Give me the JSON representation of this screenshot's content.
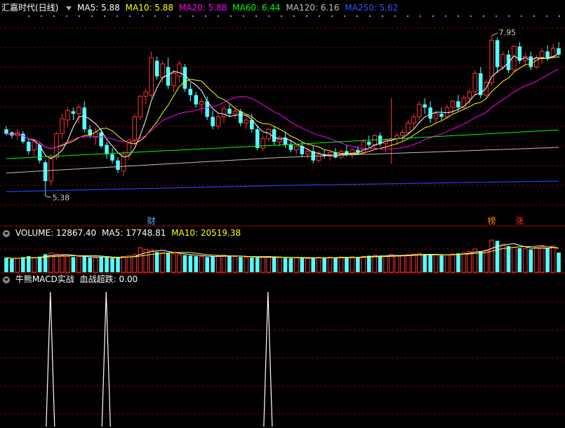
{
  "main_header": {
    "title": "汇嘉时代(日线)",
    "indicators": [
      {
        "label": "MA5: 5.88",
        "color": "#ffffff"
      },
      {
        "label": "MA10: 5.88",
        "color": "#ffff00"
      },
      {
        "label": "MA20: 5.88",
        "color": "#ff00ff"
      },
      {
        "label": "MA60: 6.44",
        "color": "#00ff00"
      },
      {
        "label": "MA120: 6.16",
        "color": "#c0c0c0"
      },
      {
        "label": "MA250: 5.62",
        "color": "#0000ff"
      }
    ]
  },
  "volume_header": {
    "indicators": [
      {
        "label": "VOLUME: 12867.40",
        "color": "#ffffff"
      },
      {
        "label": "MA5: 17748.81",
        "color": "#ffffff"
      },
      {
        "label": "MA10: 20519.38",
        "color": "#ffff00"
      }
    ]
  },
  "macd_header": {
    "name": "牛熊MACD实战",
    "indicator": "血战超跌: 0.00"
  },
  "colors": {
    "up": "#ff3232",
    "down": "#54ffff",
    "grid": "#7f0000",
    "frame": "#a00000"
  },
  "chart_data": [
    {
      "type": "candlestick",
      "title": "汇嘉时代(日线)",
      "annotations": [
        {
          "text": "7.95",
          "kind": "high_label",
          "index": 87
        },
        {
          "text": "5.38",
          "kind": "low_label",
          "index": 7
        }
      ],
      "event_markers": [
        {
          "text": "财",
          "index": 26,
          "color": "#5fafff"
        },
        {
          "text": "榜",
          "index": 87,
          "color": "#ff8c00"
        },
        {
          "text": "涨",
          "index": 92,
          "color": "#ff3232"
        }
      ],
      "ohlc": [
        [
          6.45,
          6.5,
          6.35,
          6.38
        ],
        [
          6.4,
          6.42,
          6.3,
          6.35
        ],
        [
          6.35,
          6.45,
          6.28,
          6.4
        ],
        [
          6.38,
          6.42,
          6.22,
          6.25
        ],
        [
          6.25,
          6.3,
          6.05,
          6.1
        ],
        [
          6.12,
          6.28,
          6.02,
          6.25
        ],
        [
          6.2,
          6.24,
          5.9,
          5.95
        ],
        [
          5.92,
          5.95,
          5.38,
          5.62
        ],
        [
          5.62,
          6.05,
          5.55,
          5.98
        ],
        [
          6.0,
          6.4,
          5.96,
          6.38
        ],
        [
          6.38,
          6.7,
          6.3,
          6.62
        ],
        [
          6.6,
          6.8,
          6.5,
          6.75
        ],
        [
          6.74,
          6.8,
          6.6,
          6.7
        ],
        [
          6.7,
          6.85,
          6.55,
          6.8
        ],
        [
          6.8,
          6.9,
          6.4,
          6.45
        ],
        [
          6.45,
          6.52,
          6.3,
          6.35
        ],
        [
          6.32,
          6.48,
          6.2,
          6.4
        ],
        [
          6.4,
          6.45,
          6.15,
          6.18
        ],
        [
          6.2,
          6.25,
          5.98,
          6.05
        ],
        [
          6.05,
          6.15,
          5.9,
          5.95
        ],
        [
          5.95,
          6.0,
          5.75,
          5.8
        ],
        [
          5.78,
          6.1,
          5.7,
          6.05
        ],
        [
          6.05,
          6.3,
          5.96,
          6.28
        ],
        [
          6.28,
          6.7,
          6.2,
          6.65
        ],
        [
          6.65,
          7.0,
          6.6,
          6.98
        ],
        [
          6.98,
          7.1,
          6.85,
          7.05
        ],
        [
          7.0,
          7.7,
          6.95,
          7.6
        ],
        [
          7.55,
          7.62,
          7.25,
          7.3
        ],
        [
          7.28,
          7.55,
          7.2,
          7.5
        ],
        [
          7.45,
          7.6,
          7.1,
          7.15
        ],
        [
          7.15,
          7.4,
          7.05,
          7.35
        ],
        [
          7.3,
          7.55,
          7.2,
          7.5
        ],
        [
          7.45,
          7.5,
          7.05,
          7.1
        ],
        [
          7.1,
          7.2,
          6.9,
          7.0
        ],
        [
          7.0,
          7.05,
          6.8,
          6.85
        ],
        [
          6.85,
          6.95,
          6.7,
          6.9
        ],
        [
          6.9,
          6.98,
          6.6,
          6.65
        ],
        [
          6.65,
          6.75,
          6.45,
          6.5
        ],
        [
          6.5,
          6.7,
          6.45,
          6.65
        ],
        [
          6.65,
          6.82,
          6.55,
          6.78
        ],
        [
          6.78,
          6.85,
          6.65,
          6.7
        ],
        [
          6.7,
          6.8,
          6.62,
          6.74
        ],
        [
          6.74,
          6.78,
          6.5,
          6.55
        ],
        [
          6.55,
          6.65,
          6.45,
          6.6
        ],
        [
          6.6,
          6.7,
          6.4,
          6.45
        ],
        [
          6.45,
          6.52,
          6.12,
          6.15
        ],
        [
          6.15,
          6.35,
          6.1,
          6.3
        ],
        [
          6.3,
          6.48,
          6.25,
          6.45
        ],
        [
          6.45,
          6.5,
          6.2,
          6.25
        ],
        [
          6.25,
          6.35,
          6.18,
          6.32
        ],
        [
          6.32,
          6.4,
          6.15,
          6.2
        ],
        [
          6.2,
          6.28,
          6.08,
          6.12
        ],
        [
          6.12,
          6.22,
          6.05,
          6.18
        ],
        [
          6.18,
          6.25,
          6.0,
          6.05
        ],
        [
          6.05,
          6.15,
          5.98,
          6.1
        ],
        [
          6.1,
          6.18,
          5.9,
          5.95
        ],
        [
          5.95,
          6.1,
          5.92,
          6.05
        ],
        [
          6.05,
          6.12,
          5.98,
          6.02
        ],
        [
          6.02,
          6.1,
          5.95,
          6.08
        ],
        [
          6.08,
          6.15,
          5.98,
          6.0
        ],
        [
          6.0,
          6.12,
          5.97,
          6.1
        ],
        [
          6.1,
          6.2,
          6.02,
          6.05
        ],
        [
          6.05,
          6.15,
          5.98,
          6.12
        ],
        [
          6.12,
          6.18,
          6.04,
          6.08
        ],
        [
          6.08,
          6.3,
          6.05,
          6.25
        ],
        [
          6.25,
          6.35,
          6.15,
          6.2
        ],
        [
          6.2,
          6.38,
          6.15,
          6.35
        ],
        [
          6.35,
          6.4,
          6.18,
          6.22
        ],
        [
          6.22,
          6.3,
          6.08,
          6.28
        ],
        [
          6.28,
          6.95,
          5.9,
          6.3
        ],
        [
          6.3,
          6.4,
          6.2,
          6.35
        ],
        [
          6.35,
          6.45,
          6.25,
          6.4
        ],
        [
          6.4,
          6.6,
          6.35,
          6.55
        ],
        [
          6.55,
          6.7,
          6.45,
          6.65
        ],
        [
          6.65,
          6.9,
          6.6,
          6.85
        ],
        [
          6.85,
          6.95,
          6.7,
          6.8
        ],
        [
          6.8,
          6.9,
          6.55,
          6.62
        ],
        [
          6.62,
          6.75,
          6.55,
          6.7
        ],
        [
          6.7,
          6.8,
          6.6,
          6.65
        ],
        [
          6.65,
          6.85,
          6.62,
          6.8
        ],
        [
          6.8,
          6.92,
          6.7,
          6.9
        ],
        [
          6.9,
          7.0,
          6.75,
          6.8
        ],
        [
          6.8,
          7.0,
          6.78,
          6.95
        ],
        [
          6.95,
          7.1,
          6.85,
          7.05
        ],
        [
          7.05,
          7.4,
          7.0,
          7.35
        ],
        [
          7.35,
          7.45,
          6.95,
          7.0
        ],
        [
          7.0,
          7.25,
          6.95,
          7.2
        ],
        [
          7.2,
          7.95,
          7.15,
          7.88
        ],
        [
          7.88,
          7.92,
          7.35,
          7.45
        ],
        [
          7.45,
          7.7,
          7.4,
          7.65
        ],
        [
          7.65,
          7.72,
          7.35,
          7.4
        ],
        [
          7.4,
          7.8,
          7.38,
          7.78
        ],
        [
          7.78,
          7.85,
          7.5,
          7.55
        ],
        [
          7.55,
          7.68,
          7.45,
          7.62
        ],
        [
          7.62,
          7.7,
          7.4,
          7.45
        ],
        [
          7.45,
          7.65,
          7.42,
          7.6
        ],
        [
          7.6,
          7.75,
          7.5,
          7.7
        ],
        [
          7.7,
          7.8,
          7.55,
          7.6
        ],
        [
          7.6,
          7.82,
          7.58,
          7.75
        ],
        [
          7.75,
          7.85,
          7.6,
          7.65
        ]
      ],
      "ma_series": [
        {
          "name": "MA5",
          "color": "#ffffff"
        },
        {
          "name": "MA10",
          "color": "#ffff00"
        },
        {
          "name": "MA20",
          "color": "#ff00ff"
        },
        {
          "name": "MA60",
          "color": "#00ff00"
        },
        {
          "name": "MA120",
          "color": "#c0c0c0"
        },
        {
          "name": "MA250",
          "color": "#0000ff"
        }
      ],
      "ma_values": {
        "MA60": [
          5.98,
          6.2,
          6.44
        ],
        "MA120": [
          5.75,
          6.0,
          6.16
        ],
        "MA250": [
          5.45,
          5.55,
          5.62
        ]
      }
    },
    {
      "type": "bar",
      "title": "VOLUME",
      "values": [
        9500,
        8800,
        9100,
        9800,
        10500,
        9300,
        10200,
        11800,
        12500,
        11900,
        11000,
        10400,
        9900,
        10200,
        10800,
        9700,
        9400,
        9900,
        9600,
        9200,
        9500,
        10300,
        10900,
        11500,
        16000,
        14800,
        14500,
        13200,
        12900,
        12500,
        11900,
        11400,
        11200,
        10900,
        10500,
        10200,
        9900,
        10500,
        10800,
        11100,
        10700,
        10300,
        10000,
        9800,
        9600,
        9500,
        9900,
        10300,
        9800,
        9600,
        9400,
        9200,
        9500,
        9300,
        9100,
        9400,
        9700,
        9600,
        9800,
        9500,
        9900,
        9700,
        10000,
        9800,
        10400,
        10800,
        11200,
        10700,
        10500,
        11600,
        10800,
        11100,
        11400,
        11800,
        12300,
        11700,
        11200,
        11500,
        11000,
        11400,
        11900,
        12400,
        12800,
        13500,
        15200,
        13800,
        14500,
        21000,
        20500,
        18300,
        17100,
        16200,
        15800,
        15400,
        14900,
        16200,
        16800,
        15600,
        17200,
        12867
      ],
      "ma5": 17748.81,
      "ma10": 20519.38
    },
    {
      "type": "line",
      "title": "牛熊MACD实战",
      "series": [
        {
          "name": "血战超跌",
          "values": [
            0,
            0,
            0,
            0,
            0,
            0,
            0,
            0,
            0,
            0,
            0,
            0,
            0,
            0,
            0,
            0,
            0,
            0,
            0,
            0,
            0,
            0,
            0,
            0,
            0,
            0,
            0,
            0,
            0,
            0,
            0,
            0,
            0,
            0,
            0,
            0,
            0,
            0,
            0,
            0,
            0,
            0,
            0,
            0,
            0,
            0,
            0,
            0,
            0,
            0,
            0,
            0,
            0,
            0,
            0,
            0,
            0,
            0,
            0,
            0,
            0,
            0,
            0,
            0,
            0,
            0,
            0,
            0,
            0,
            0,
            0,
            0,
            0,
            0,
            0,
            0,
            0,
            0,
            0,
            0,
            0,
            0,
            0,
            0,
            0,
            0,
            0,
            0,
            0,
            0,
            0,
            0,
            0,
            0,
            0,
            0,
            0,
            0,
            0,
            0
          ]
        }
      ],
      "spikes_at": [
        7,
        17,
        46
      ],
      "spike_peak": 100
    }
  ]
}
